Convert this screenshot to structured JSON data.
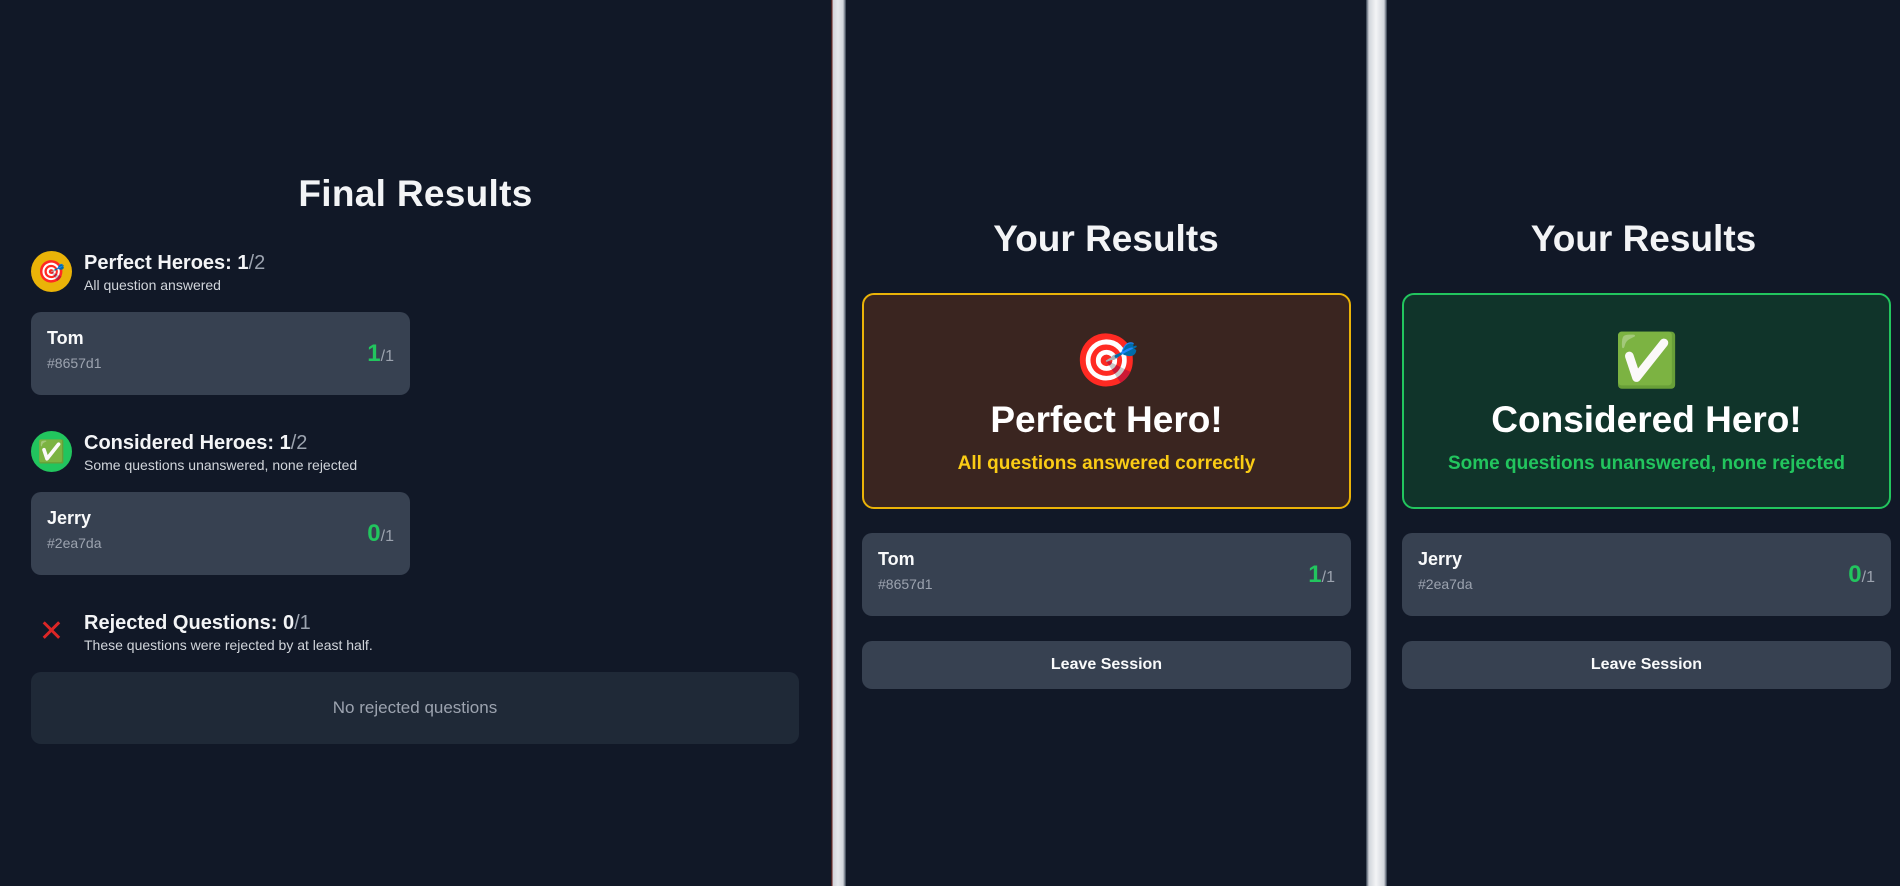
{
  "host": {
    "title": "Final Results",
    "perfect": {
      "icon": "target-icon",
      "icon_glyph": "🎯",
      "label": "Perfect Heroes: ",
      "count": "1",
      "total": "/2",
      "subtitle": "All question answered",
      "players": [
        {
          "name": "Tom",
          "id": "#8657d1",
          "score": "1",
          "out_of": "/1"
        }
      ]
    },
    "considered": {
      "icon": "check-icon",
      "icon_glyph": "✅",
      "label": "Considered Heroes: ",
      "count": "1",
      "total": "/2",
      "subtitle": "Some questions unanswered, none rejected",
      "players": [
        {
          "name": "Jerry",
          "id": "#2ea7da",
          "score": "0",
          "out_of": "/1"
        }
      ]
    },
    "rejected": {
      "icon": "cross-icon",
      "icon_glyph": "❌",
      "label": "Rejected Questions: ",
      "count": "0",
      "total": "/1",
      "subtitle": "These questions were rejected by at least half.",
      "empty_text": "No rejected questions"
    }
  },
  "tom_view": {
    "title": "Your Results",
    "hero_icon": "target-icon",
    "hero_glyph": "🎯",
    "hero_title": "Perfect Hero!",
    "hero_subtitle": "All questions answered correctly",
    "player": {
      "name": "Tom",
      "id": "#8657d1",
      "score": "1",
      "out_of": "/1"
    },
    "leave_label": "Leave Session"
  },
  "jerry_view": {
    "title": "Your Results",
    "hero_icon": "check-icon",
    "hero_glyph": "✅",
    "hero_title": "Considered Hero!",
    "hero_subtitle": "Some questions unanswered, none rejected",
    "player": {
      "name": "Jerry",
      "id": "#2ea7da",
      "score": "0",
      "out_of": "/1"
    },
    "leave_label": "Leave Session"
  },
  "colors": {
    "background": "#111827",
    "card": "#374151",
    "gold": "#eab308",
    "green": "#22c55e"
  }
}
